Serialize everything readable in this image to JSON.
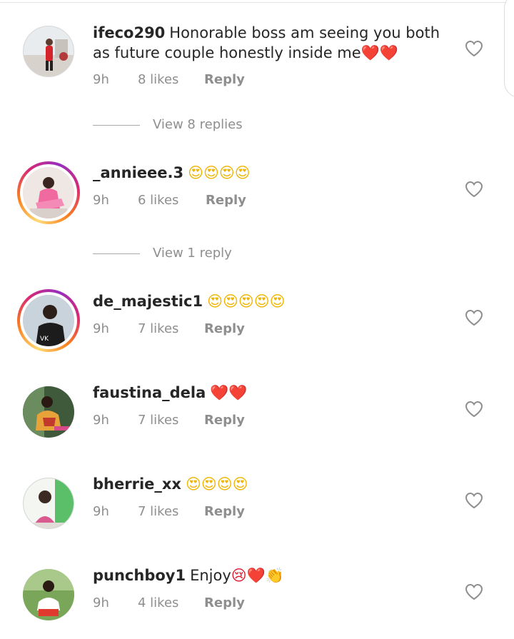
{
  "colors": {
    "text": "#262626",
    "muted": "#8e8e8e",
    "story_ring_start": "#feda75",
    "story_ring_end": "#962fbf",
    "heart_outline": "#8e8e8e",
    "emoji_heart": "#e0142d"
  },
  "comments": [
    {
      "username": "ifeco290",
      "text": "Honorable boss am seeing you both as future couple honestly inside me",
      "emojis": "❤️❤️",
      "time": "9h",
      "likes": "8 likes",
      "reply": "Reply",
      "story_ring": false,
      "view_replies": "View 8 replies"
    },
    {
      "username": "_annieee.3",
      "text": "",
      "emojis": "😍😍😍😍",
      "time": "9h",
      "likes": "6 likes",
      "reply": "Reply",
      "story_ring": true,
      "view_replies": "View 1 reply"
    },
    {
      "username": "de_majestic1",
      "text": "",
      "emojis": "😍😍😍😍😍",
      "time": "9h",
      "likes": "7 likes",
      "reply": "Reply",
      "story_ring": true
    },
    {
      "username": "faustina_dela",
      "text": "",
      "emojis": "❤️❤️",
      "time": "9h",
      "likes": "7 likes",
      "reply": "Reply",
      "story_ring": false
    },
    {
      "username": "bherrie_xx",
      "text": "",
      "emojis": "😍😍😍😍",
      "time": "9h",
      "likes": "7 likes",
      "reply": "Reply",
      "story_ring": false
    },
    {
      "username": "punchboy1",
      "text": "Enjoy",
      "emojis": "😢❤️👏",
      "time": "9h",
      "likes": "4 likes",
      "reply": "Reply",
      "story_ring": false
    }
  ],
  "icons": {
    "like": "heart-outline-icon"
  }
}
